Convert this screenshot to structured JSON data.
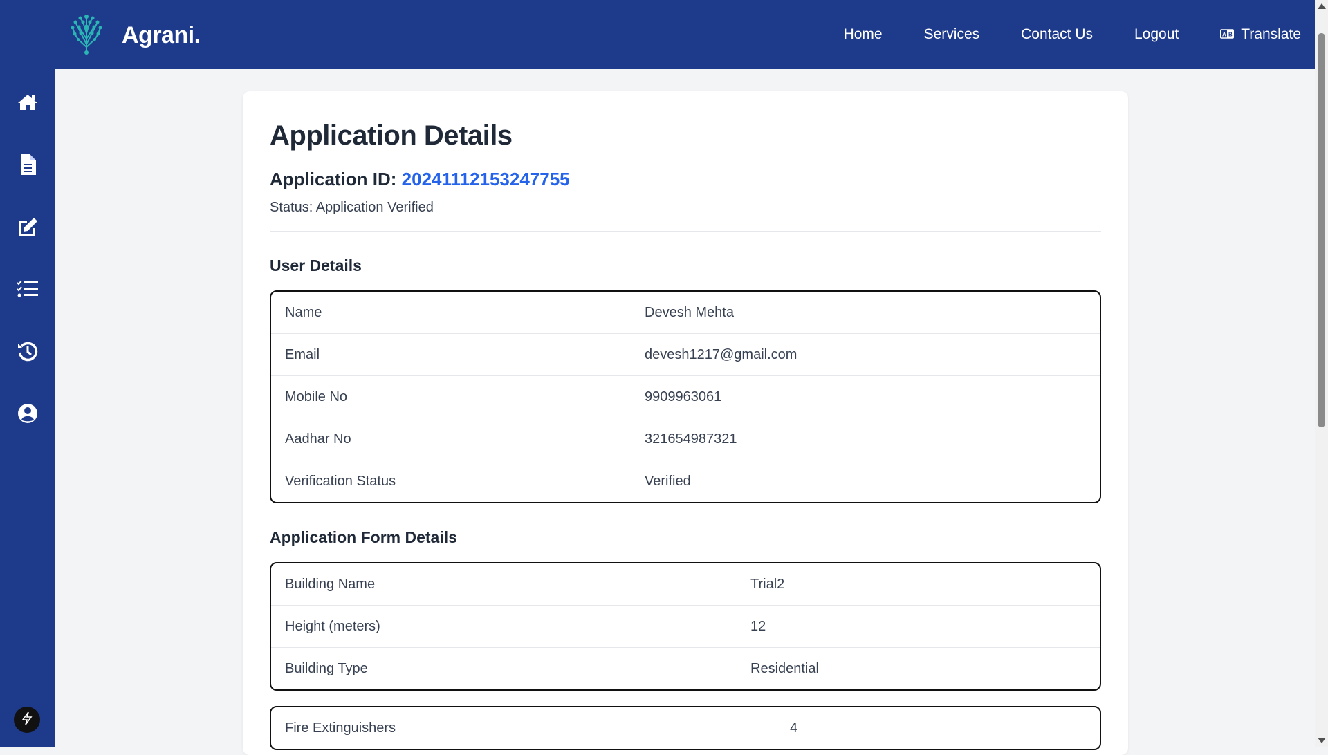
{
  "header": {
    "brand": "Agrani.",
    "nav": [
      "Home",
      "Services",
      "Contact Us",
      "Logout"
    ],
    "translate_label": "Translate"
  },
  "sidebar": {
    "icons": [
      "home-icon",
      "document-icon",
      "edit-icon",
      "task-list-icon",
      "history-icon",
      "user-circle-icon"
    ]
  },
  "page": {
    "title": "Application Details",
    "app_id_label": "Application ID: ",
    "app_id": "20241112153247755",
    "status": "Status: Application Verified"
  },
  "user_details": {
    "heading": "User Details",
    "rows": [
      {
        "label": "Name",
        "value": "Devesh Mehta"
      },
      {
        "label": "Email",
        "value": "devesh1217@gmail.com"
      },
      {
        "label": "Mobile No",
        "value": "9909963061"
      },
      {
        "label": "Aadhar No",
        "value": "321654987321"
      },
      {
        "label": "Verification Status",
        "value": "Verified"
      }
    ]
  },
  "form_details": {
    "heading": "Application Form Details",
    "rows": [
      {
        "label": "Building Name",
        "value": "Trial2"
      },
      {
        "label": "Height (meters)",
        "value": "12"
      },
      {
        "label": "Building Type",
        "value": "Residential"
      }
    ],
    "partial_rows": [
      {
        "label": "Fire Extinguishers",
        "value": "4"
      }
    ]
  },
  "colors": {
    "primary": "#1e3a8a",
    "link": "#2563eb",
    "logo": "#2bb5b5"
  }
}
